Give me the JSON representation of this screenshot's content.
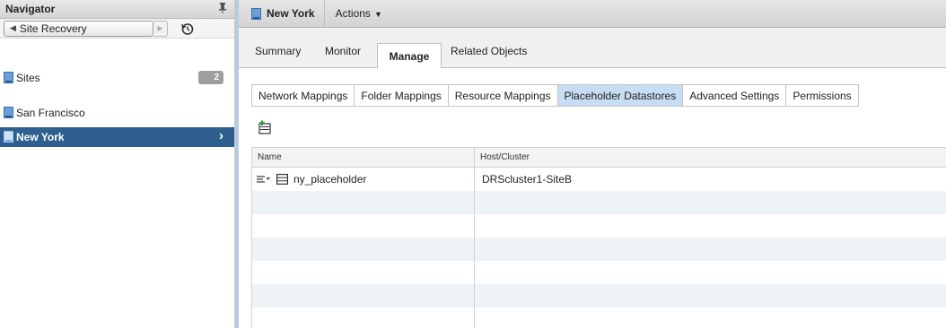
{
  "navigator": {
    "title": "Navigator",
    "back_label": "Site Recovery",
    "items": [
      {
        "label": "Sites",
        "badge": "2"
      },
      {
        "label": "San Francisco"
      },
      {
        "label": "New York"
      }
    ]
  },
  "object": {
    "title": "New York",
    "actions_label": "Actions"
  },
  "main_tabs": {
    "summary": "Summary",
    "monitor": "Monitor",
    "manage": "Manage",
    "related": "Related Objects"
  },
  "sub_tabs": [
    "Network Mappings",
    "Folder Mappings",
    "Resource Mappings",
    "Placeholder Datastores",
    "Advanced Settings",
    "Permissions"
  ],
  "grid": {
    "columns": [
      "Name",
      "Host/Cluster"
    ],
    "rows": [
      {
        "name": "ny_placeholder",
        "host": "DRScluster1-SiteB"
      }
    ]
  },
  "colors": {
    "selected_row": "#2f5f8f",
    "active_subtab": "#c7ddf3",
    "splitter": "#b7cbe0",
    "badge": "#9e9e9e"
  },
  "icons": [
    "pin-icon",
    "history-icon",
    "site-icon",
    "chevron-right-icon",
    "add-datastore-icon",
    "row-menu-icon",
    "datastore-icon"
  ]
}
